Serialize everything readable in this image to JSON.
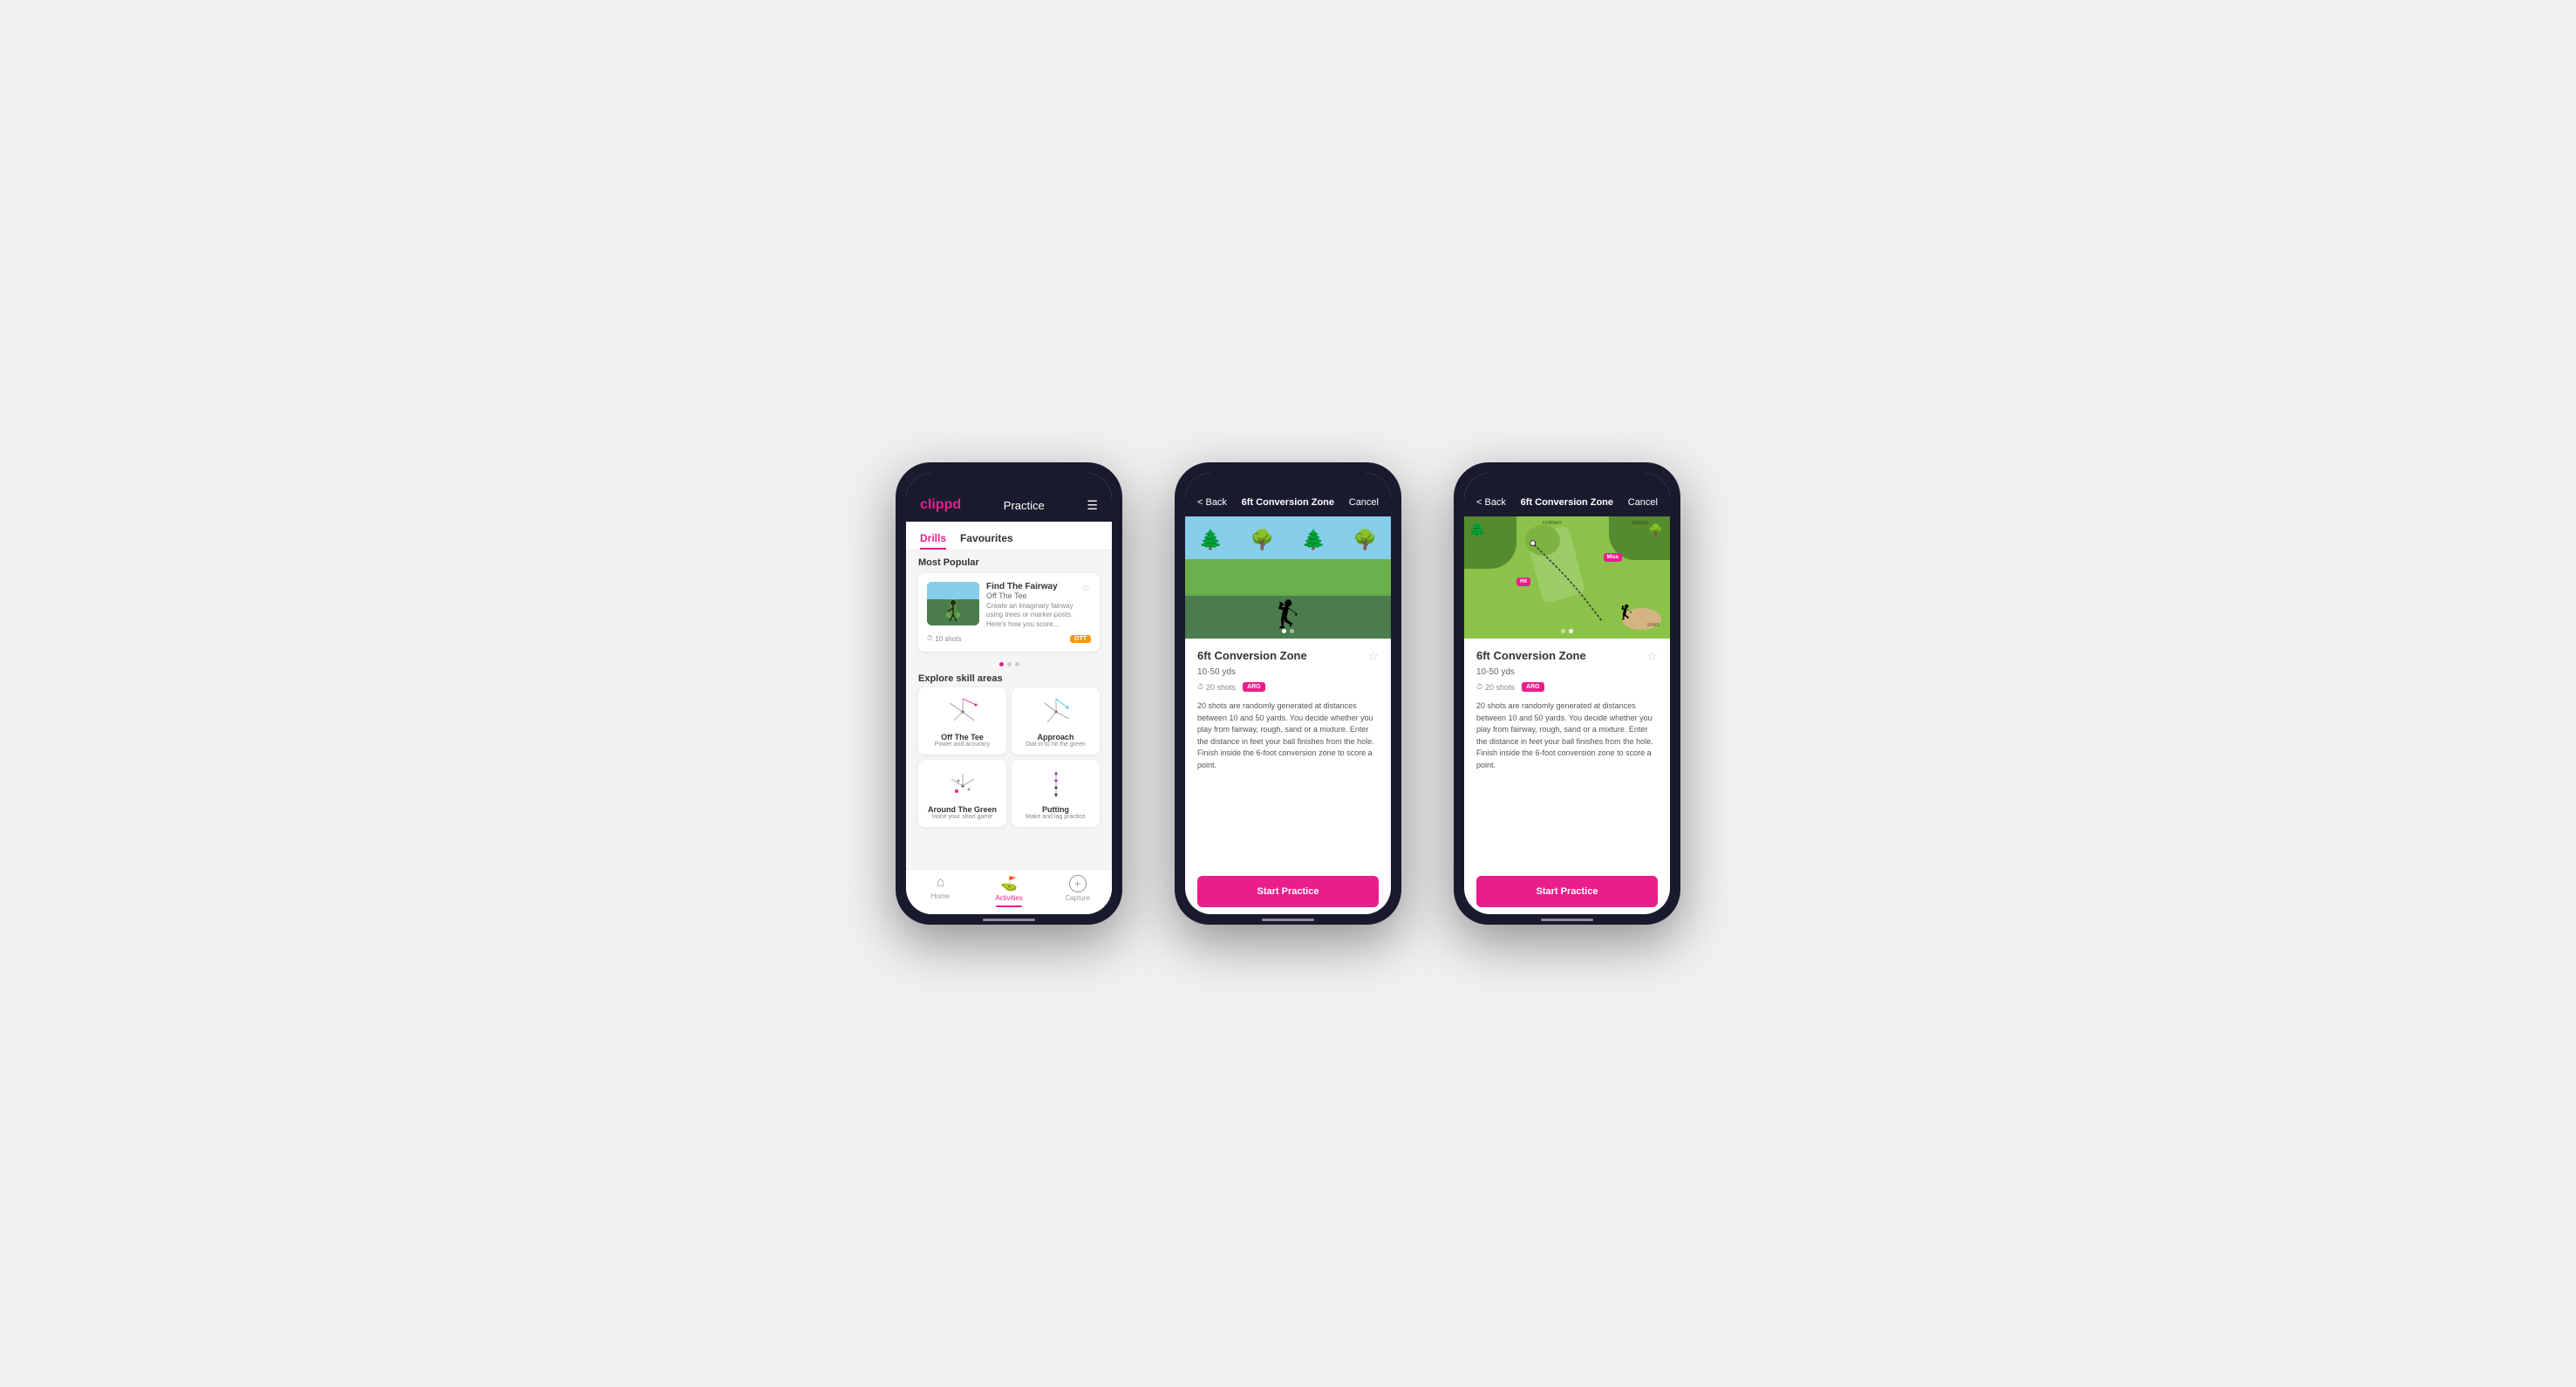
{
  "phone1": {
    "header": {
      "logo": "clippd",
      "title": "Practice",
      "menu_icon": "☰"
    },
    "tabs": [
      {
        "label": "Drills",
        "active": true
      },
      {
        "label": "Favourites",
        "active": false
      }
    ],
    "most_popular_title": "Most Popular",
    "featured_drill": {
      "title": "Find The Fairway",
      "subtitle": "Off The Tee",
      "description": "Create an imaginary fairway using trees or marker posts. Here's how you score...",
      "shots": "10 shots",
      "tag": "OTT"
    },
    "explore_title": "Explore skill areas",
    "skills": [
      {
        "name": "Off The Tee",
        "desc": "Power and accuracy"
      },
      {
        "name": "Approach",
        "desc": "Dial-in to hit the green"
      },
      {
        "name": "Around The Green",
        "desc": "Hone your short game"
      },
      {
        "name": "Putting",
        "desc": "Make and lag practice"
      }
    ],
    "bottom_nav": [
      {
        "label": "Home",
        "icon": "⌂",
        "active": false
      },
      {
        "label": "Activities",
        "icon": "⛳",
        "active": true
      },
      {
        "label": "Capture",
        "icon": "+",
        "active": false
      }
    ]
  },
  "phone2": {
    "header": {
      "back": "< Back",
      "title": "6ft Conversion Zone",
      "cancel": "Cancel"
    },
    "drill": {
      "name": "6ft Conversion Zone",
      "range": "10-50 yds",
      "shots": "20 shots",
      "tag": "ARG",
      "description": "20 shots are randomly generated at distances between 10 and 50 yards. You decide whether you play from fairway, rough, sand or a mixture. Enter the distance in feet your ball finishes from the hole. Finish inside the 6-foot conversion zone to score a point.",
      "start_button": "Start Practice"
    }
  },
  "phone3": {
    "header": {
      "back": "< Back",
      "title": "6ft Conversion Zone",
      "cancel": "Cancel"
    },
    "drill": {
      "name": "6ft Conversion Zone",
      "range": "10-50 yds",
      "shots": "20 shots",
      "tag": "ARG",
      "description": "20 shots are randomly generated at distances between 10 and 50 yards. You decide whether you play from fairway, rough, sand or a mixture. Enter the distance in feet your ball finishes from the hole. Finish inside the 6-foot conversion zone to score a point.",
      "start_button": "Start Practice"
    },
    "map_labels": {
      "fairway": "FAIRWAY",
      "rough": "ROUGH",
      "sand": "SAND",
      "miss": "Miss",
      "hit": "Hit"
    }
  }
}
